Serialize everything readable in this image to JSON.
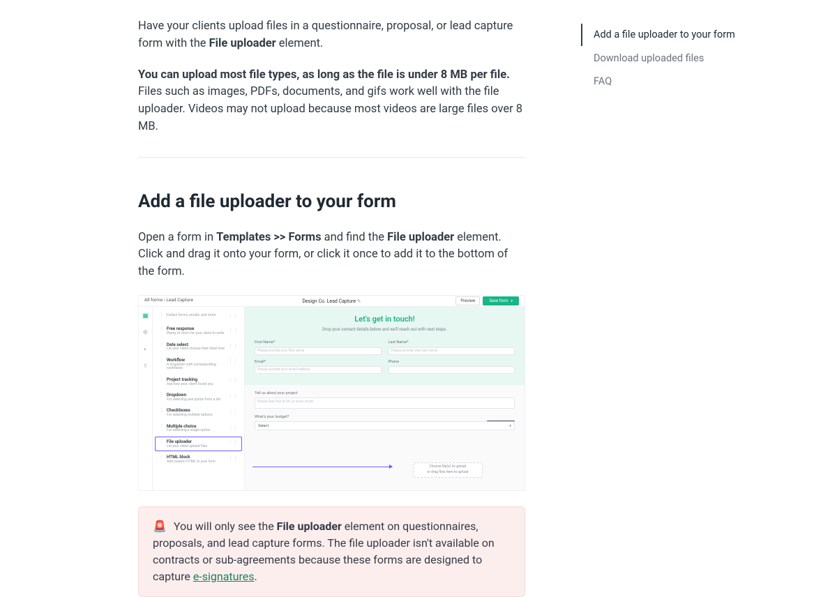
{
  "intro": {
    "p1_a": "Have your clients upload files in a questionnaire, proposal, or lead capture form with the ",
    "p1_bold": "File uploader",
    "p1_b": " element.",
    "p2_bold": "You can upload most file types, as long as the file is under 8 MB per file.",
    "p2_rest": " Files such as images, PDFs, documents, and gifs work well with the file uploader. Videos may not upload because most videos are large files over 8 MB."
  },
  "section": {
    "heading": "Add a file uploader to your form",
    "p_a": "Open a form in ",
    "p_bold1": "Templates >> Forms",
    "p_b": " and find the ",
    "p_bold2": "File uploader",
    "p_c": " element. Click and drag it onto your form, or click it once to add it to the bottom of the form."
  },
  "toc": {
    "item1": "Add a file uploader to your form",
    "item2": "Download uploaded files",
    "item3": "FAQ"
  },
  "shot": {
    "breadcrumb": "All forms  ›  Lead Capture",
    "title": "Design Co. Lead Capture",
    "preview": "Preview",
    "save": "Save form",
    "elements": [
      {
        "t1": "",
        "t2": "Collect forms, emails, and more"
      },
      {
        "t1": "Free response",
        "t2": "Plenty of room for your client to write"
      },
      {
        "t1": "Date select",
        "t2": "Let your client choose their ideal time"
      },
      {
        "t1": "Workflow",
        "t2": "A dropdown with corresponding workflows"
      },
      {
        "t1": "Project tracking",
        "t2": "Ask how your client found you"
      },
      {
        "t1": "Dropdown",
        "t2": "For selecting one option from a list"
      },
      {
        "t1": "Checkboxes",
        "t2": "For selecting multiple options"
      },
      {
        "t1": "Multiple choice",
        "t2": "For selecting a single option"
      },
      {
        "t1": "File uploader",
        "t2": "Let your client upload files"
      },
      {
        "t1": "HTML block",
        "t2": "Add custom HTML to your form"
      }
    ],
    "hero_title": "Let's get in touch!",
    "hero_sub": "Drop your contact details below and we'll reach out with next steps.",
    "first_label": "First Name*",
    "last_label": "Last Name*",
    "first_ph": "Please provide your first name",
    "last_ph": "Please provide your last name",
    "email_label": "Email*",
    "phone_label": "Phone",
    "email_ph": "Please provide your email address",
    "about_label": "Tell us about your project",
    "about_ph": "Please feel free to let us know more!",
    "budget_label": "What's your budget?",
    "budget_value": "Select",
    "drop_l1": "Choose file(s) to upload",
    "drop_l2": "or drag files here to upload"
  },
  "callout": {
    "emoji": "🚨",
    "t1": "  You will only see the ",
    "bold": "File uploader",
    "t2": " element on questionnaires, proposals, and lead capture forms. The file uploader isn't available on contracts or sub-agreements because these forms are designed to capture ",
    "link": "e-signatures",
    "t3": "."
  }
}
